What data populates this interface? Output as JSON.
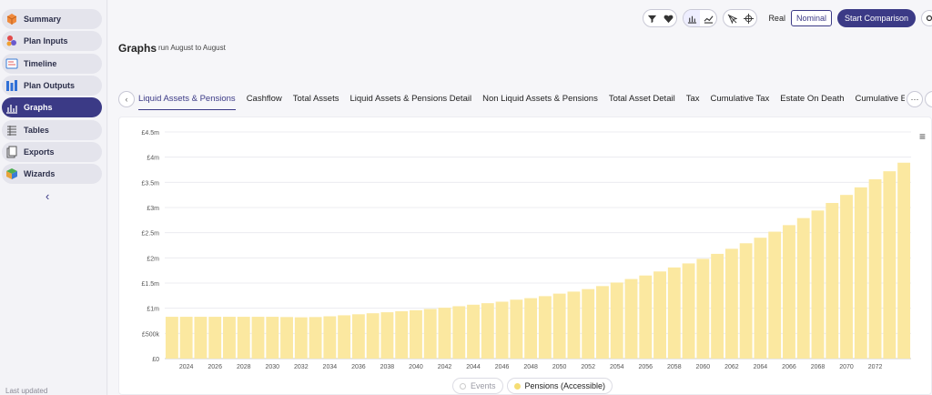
{
  "sidebar": {
    "items": [
      {
        "label": "Summary",
        "icon": "summary-box-icon"
      },
      {
        "label": "Plan Inputs",
        "icon": "plan-inputs-icon"
      },
      {
        "label": "Timeline",
        "icon": "timeline-icon"
      },
      {
        "label": "Plan Outputs",
        "icon": "plan-outputs-icon"
      },
      {
        "label": "Graphs",
        "icon": "graph-icon",
        "active": true
      },
      {
        "label": "Tables",
        "icon": "table-icon"
      },
      {
        "label": "Exports",
        "icon": "exports-icon"
      },
      {
        "label": "Wizards",
        "icon": "wizard-icon"
      }
    ],
    "collapse_glyph": "‹",
    "last_updated": "Last updated"
  },
  "header": {
    "title": "Graphs",
    "subtitle": "run August to August"
  },
  "toolbar": {
    "real_label": "Real",
    "nominal_label": "Nominal",
    "start_label": "Start Comparison"
  },
  "tabs": [
    "Liquid Assets & Pensions",
    "Cashflow",
    "Total Assets",
    "Liquid Assets & Pensions Detail",
    "Non Liquid Assets & Pensions",
    "Total Asset Detail",
    "Tax",
    "Cumulative Tax",
    "Estate On Death",
    "Cumulative Estate"
  ],
  "active_tab": 0,
  "chart_menu_glyph": "≡",
  "legend": {
    "events": "Events",
    "pensions": "Pensions (Accessible)"
  },
  "colors": {
    "accent": "#3b3a86",
    "bar": "#fbe8a0"
  },
  "chart_data": {
    "type": "bar",
    "title": "",
    "xlabel": "",
    "ylabel": "",
    "ylim": [
      0,
      4500000
    ],
    "yticks": [
      "£0",
      "£500k",
      "£1m",
      "£1.5m",
      "£2m",
      "£2.5m",
      "£3m",
      "£3.5m",
      "£4m",
      "£4.5m"
    ],
    "xticks": [
      "2024",
      "2026",
      "2028",
      "2030",
      "2032",
      "2034",
      "2036",
      "2038",
      "2040",
      "2042",
      "2044",
      "2046",
      "2048",
      "2050",
      "2052",
      "2054",
      "2056",
      "2058",
      "2060",
      "2062",
      "2064",
      "2066",
      "2068",
      "2070",
      "2072"
    ],
    "categories": [
      "2023",
      "2024",
      "2025",
      "2026",
      "2027",
      "2028",
      "2029",
      "2030",
      "2031",
      "2032",
      "2033",
      "2034",
      "2035",
      "2036",
      "2037",
      "2038",
      "2039",
      "2040",
      "2041",
      "2042",
      "2043",
      "2044",
      "2045",
      "2046",
      "2047",
      "2048",
      "2049",
      "2050",
      "2051",
      "2052",
      "2053",
      "2054",
      "2055",
      "2056",
      "2057",
      "2058",
      "2059",
      "2060",
      "2061",
      "2062",
      "2063",
      "2064",
      "2065",
      "2066",
      "2067",
      "2068",
      "2069",
      "2070",
      "2071",
      "2072"
    ],
    "series": [
      {
        "name": "Pensions (Accessible)",
        "values": [
          830000,
          830000,
          830000,
          830000,
          830000,
          830000,
          830000,
          830000,
          825000,
          820000,
          825000,
          840000,
          860000,
          880000,
          900000,
          920000,
          940000,
          960000,
          985000,
          1010000,
          1040000,
          1070000,
          1100000,
          1130000,
          1170000,
          1200000,
          1240000,
          1290000,
          1330000,
          1380000,
          1440000,
          1510000,
          1580000,
          1650000,
          1730000,
          1810000,
          1890000,
          1980000,
          2080000,
          2180000,
          2290000,
          2400000,
          2520000,
          2650000,
          2790000,
          2940000,
          3090000,
          3250000,
          3400000,
          3560000,
          3720000,
          3890000
        ]
      }
    ]
  }
}
